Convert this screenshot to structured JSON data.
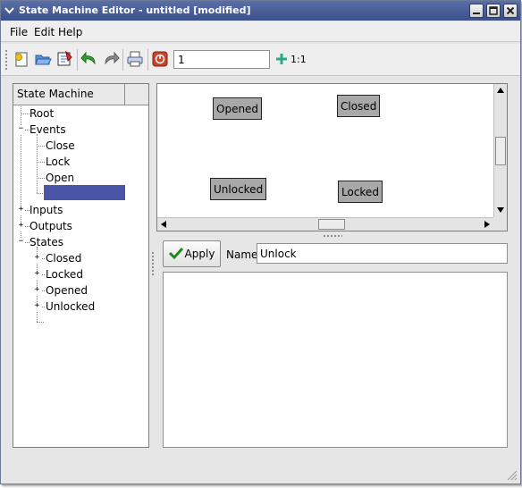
{
  "window": {
    "title": "State Machine Editor - untitled [modified]",
    "controls": [
      "minimize-icon",
      "maximize-icon",
      "close-icon"
    ]
  },
  "menu": {
    "items": [
      "File",
      "Edit",
      "Help"
    ]
  },
  "toolbar": {
    "buttons": [
      "new-icon",
      "open-icon",
      "save-icon",
      "undo-icon",
      "redo-icon",
      "print-icon",
      "stop-icon",
      "zoom-in-icon"
    ],
    "zoom_value": "1",
    "one_to_one_label": "1:1"
  },
  "tree": {
    "header": "State Machine",
    "nodes": {
      "root": "Root",
      "events": "Events",
      "event_close": "Close",
      "event_lock": "Lock",
      "event_open": "Open",
      "inputs": "Inputs",
      "outputs": "Outputs",
      "states": "States",
      "state_closed": "Closed",
      "state_locked": "Locked",
      "state_opened": "Opened",
      "state_unlocked": "Unlocked"
    }
  },
  "canvas": {
    "states": [
      "Opened",
      "Closed",
      "Unlocked",
      "Locked"
    ]
  },
  "properties": {
    "apply_label": "Apply",
    "name_label": "Name",
    "name_value": "Unlock"
  },
  "colors": {
    "titlebar": "#3b4f8a",
    "selection": "#4b55a8",
    "state_fill": "#a8a8a8",
    "apply_check": "#1f8a1f"
  }
}
